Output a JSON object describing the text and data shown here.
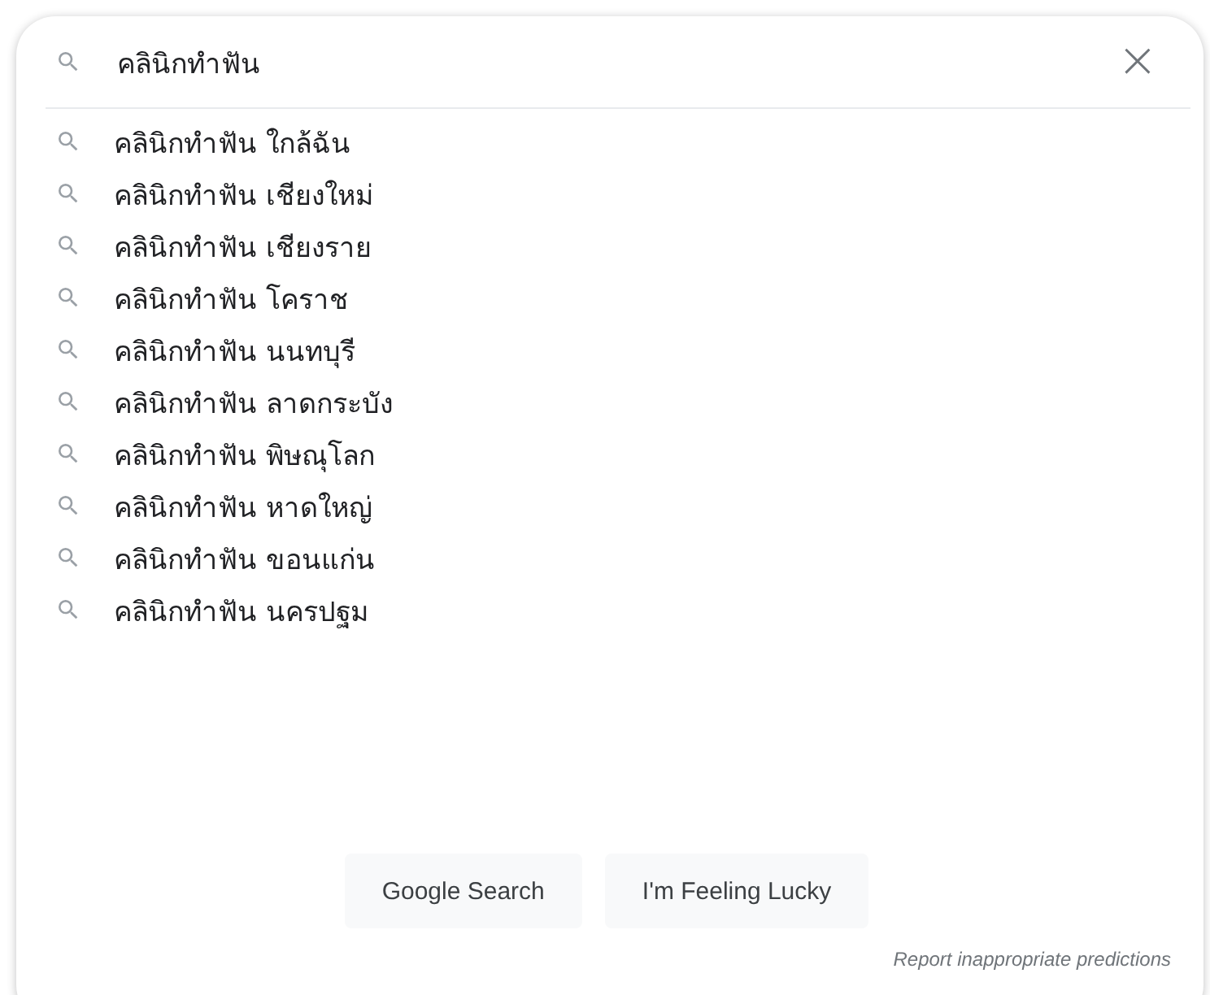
{
  "search": {
    "value": "คลินิกทำฟัน",
    "clear_label": "×"
  },
  "suggestions": [
    {
      "text": "คลินิกทำฟัน ใกล้ฉัน"
    },
    {
      "text": "คลินิกทำฟัน เชียงใหม่"
    },
    {
      "text": "คลินิกทำฟัน เชียงราย"
    },
    {
      "text": "คลินิกทำฟัน โคราช"
    },
    {
      "text": "คลินิกทำฟัน นนทบุรี"
    },
    {
      "text": "คลินิกทำฟัน ลาดกระบัง"
    },
    {
      "text": "คลินิกทำฟัน พิษณุโลก"
    },
    {
      "text": "คลินิกทำฟัน หาดใหญ่"
    },
    {
      "text": "คลินิกทำฟัน ขอนแก่น"
    },
    {
      "text": "คลินิกทำฟัน นครปฐม"
    }
  ],
  "buttons": [
    "Google Search",
    "I'm Feeling Lucky"
  ],
  "report_link": "Report inappropriate predictions"
}
